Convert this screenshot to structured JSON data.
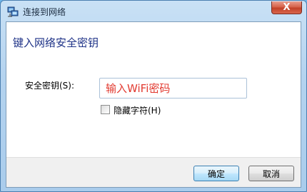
{
  "window": {
    "title": "连接到网络",
    "close_label": "X",
    "icon": "network-icon"
  },
  "main": {
    "heading": "键入网络安全密钥",
    "key_label": "安全密钥(S):",
    "key_value": "输入WiFi密码",
    "hide_chars_label": "隐藏字符(H)",
    "hide_chars_checked": false
  },
  "footer": {
    "ok_label": "确定",
    "cancel_label": "取消"
  },
  "colors": {
    "heading": "#1e3287",
    "input_text": "#e23a30",
    "close_button": "#c24128"
  }
}
